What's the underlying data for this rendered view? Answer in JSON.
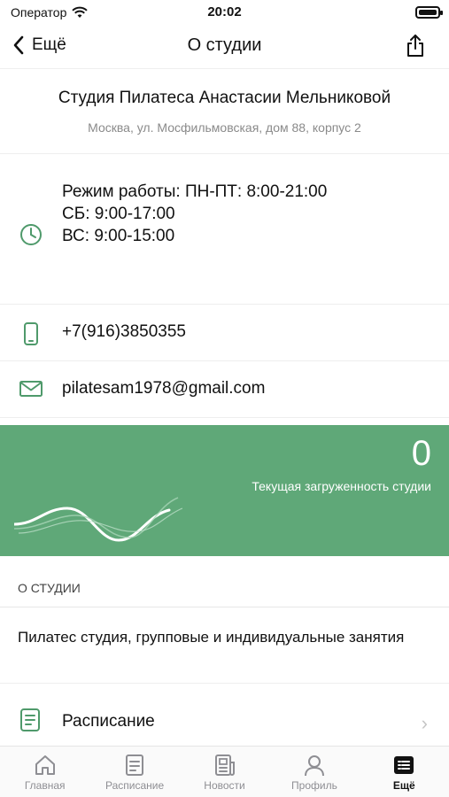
{
  "status_bar": {
    "carrier": "Оператор",
    "time": "20:02"
  },
  "nav": {
    "back_label": "Ещё",
    "title": "О студии"
  },
  "studio": {
    "name": "Студия Пилатеса Анастасии Мельниковой",
    "address": "Москва, ул. Мосфильмовская, дом 88, корпус 2"
  },
  "hours": {
    "line1": "Режим работы: ПН-ПТ: 8:00-21:00",
    "line2": "СБ: 9:00-17:00",
    "line3": "ВС: 9:00-15:00"
  },
  "contacts": {
    "phone": "+7(916)3850355",
    "email": "pilatesam1978@gmail.com"
  },
  "load": {
    "count": "0",
    "label": "Текущая загруженность студии"
  },
  "about_section": {
    "header": "О СТУДИИ",
    "text": "Пилатес студия, групповые и индивидуальные занятия"
  },
  "schedule": {
    "label": "Расписание"
  },
  "tabs": [
    {
      "label": "Главная",
      "icon": "home-icon"
    },
    {
      "label": "Расписание",
      "icon": "schedule-icon"
    },
    {
      "label": "Новости",
      "icon": "news-icon"
    },
    {
      "label": "Профиль",
      "icon": "profile-icon"
    },
    {
      "label": "Ещё",
      "icon": "more-icon",
      "active": true
    }
  ],
  "colors": {
    "accent": "#5fa878",
    "icon_green": "#4f9a6b"
  }
}
